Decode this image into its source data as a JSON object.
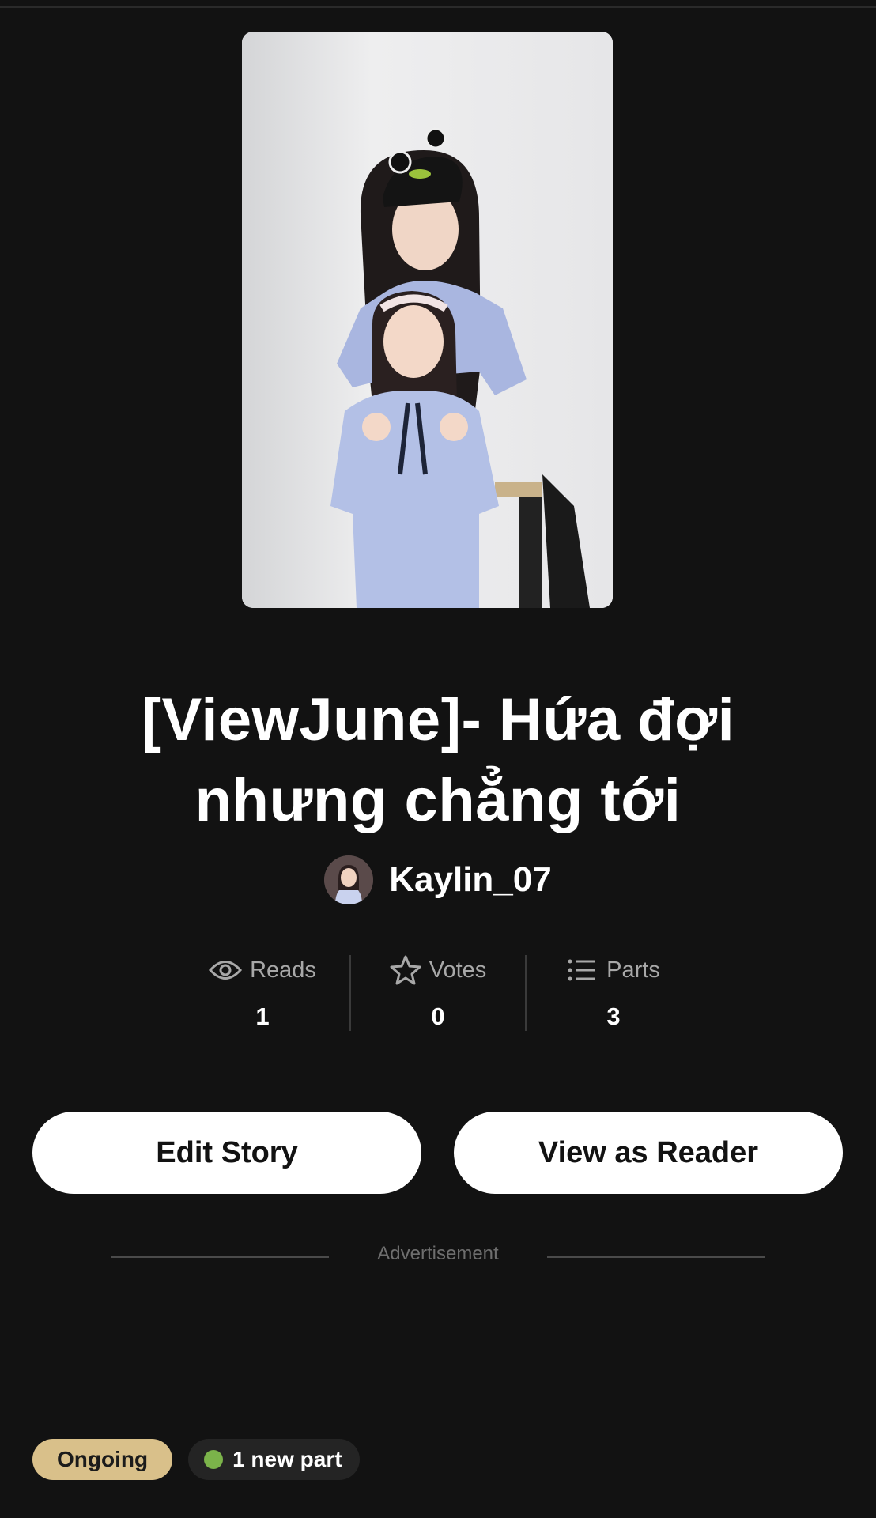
{
  "story": {
    "title": "[ViewJune]- Hứa đợi nhưng chẳng tới",
    "author": "Kaylin_07"
  },
  "stats": {
    "reads": {
      "label": "Reads",
      "value": "1",
      "icon": "eye-icon"
    },
    "votes": {
      "label": "Votes",
      "value": "0",
      "icon": "star-icon"
    },
    "parts": {
      "label": "Parts",
      "value": "3",
      "icon": "list-icon"
    }
  },
  "actions": {
    "edit_label": "Edit Story",
    "view_label": "View as Reader"
  },
  "ad": {
    "label": "Advertisement"
  },
  "badges": {
    "status": "Ongoing",
    "new_parts": "1 new part"
  },
  "colors": {
    "background": "#121212",
    "status_badge": "#d9c08a",
    "new_dot": "#7bb34a"
  }
}
